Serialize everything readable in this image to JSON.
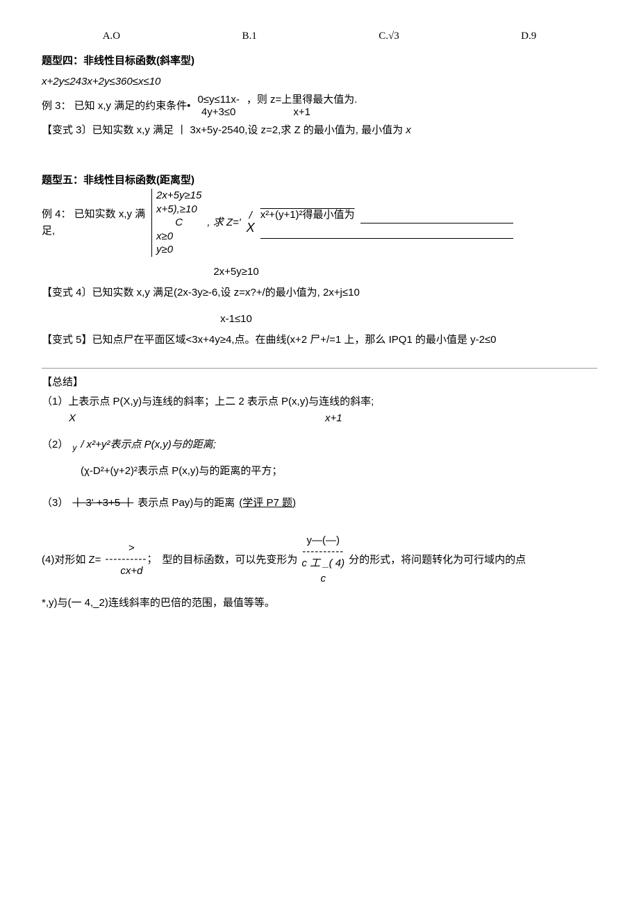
{
  "options": {
    "a": "A.O",
    "b": "B.1",
    "c": "C.√3",
    "d": "D.9"
  },
  "t4": {
    "title": "题型四：非线性目标函数(斜率型)",
    "constraint_line": "x+2y≤243x+2y≤360≤x≤10",
    "ex3": {
      "label": "例 3： 已知 x,y 满足的约束条件•",
      "c1": "0≤y≤11x-",
      "c2": "4y+3≤0",
      "tail": "，则 z=上里得最大值为.",
      "sub": "x+1"
    },
    "var3": {
      "pre": "【变式 3〕已知实数 x,y 满足 ",
      "bar": "丨",
      "mid": " 3x+5y-2540,设 z=2,求 Z 的最小值为, 最小值为 ",
      "x": "x"
    }
  },
  "t5": {
    "title": "题型五：非线性目标函数(距离型)",
    "ex4": {
      "label1": "例 4： 已知实数 x,y 满",
      "label2": "足,",
      "c1": "2x+5y≥15",
      "c2": "x+5),≥10",
      "c3": "C",
      "c4": "x≥0",
      "c5": "y≥0",
      "mid": ", 求 Z='",
      "slash": "/",
      "expr": "x²+(y+1)²得最小值为",
      "bigX": "X"
    },
    "extra_constraint": "2x+5y≥10",
    "var4": "【变式 4〕已知实数 x,y 满足(2x-3y≥-6,设 z=x?+/的最小值为, 2x+j≤10",
    "mid_constraint": "x-1≤10",
    "var5": "【变式 5】已知点尸在平面区域<3x+4y≥4,点。在曲线(x+2 尸+/=1 上，那么 IPQ1 的最小值是 y-2≤0"
  },
  "summary": {
    "heading": "【总结】",
    "s1": {
      "main": "（1）上表示点 P(X,y)与连线的斜率；上二 2 表示点 P(x,y)与连线的斜率;",
      "sub1": "X",
      "sub2": "x+1"
    },
    "s2": {
      "label": "（2）",
      "sub": "y",
      "main": " / x²+y²表示点 P(x,y)与的距离;"
    },
    "s2b": "(χ-D²+(y+2)²表示点 P(x,y)与的距离的平方；",
    "s3": {
      "label": "（3）",
      "strike": "丨 3' +3+5 丨",
      "main": "表示点 Pay)与的距离",
      "link": "(学评 P7 题)"
    },
    "s4": {
      "pre": "(4)对形如 Z=",
      "dash": "----------",
      "semi": "；",
      "sup": ">",
      "bot1": "cx+d",
      "mid1": " 型的目标函数，可以先变形为 ",
      "top2": "y—(—)",
      "dash2": "----------",
      "bot2a": "c 工 _( 4)",
      "bot2b": "c",
      "mid2": "分的形式，将问题转化为可行域内的点"
    },
    "s5": "*,y)与(一 4,_2)连线斜率的巴倍的范围，最值等等。"
  }
}
